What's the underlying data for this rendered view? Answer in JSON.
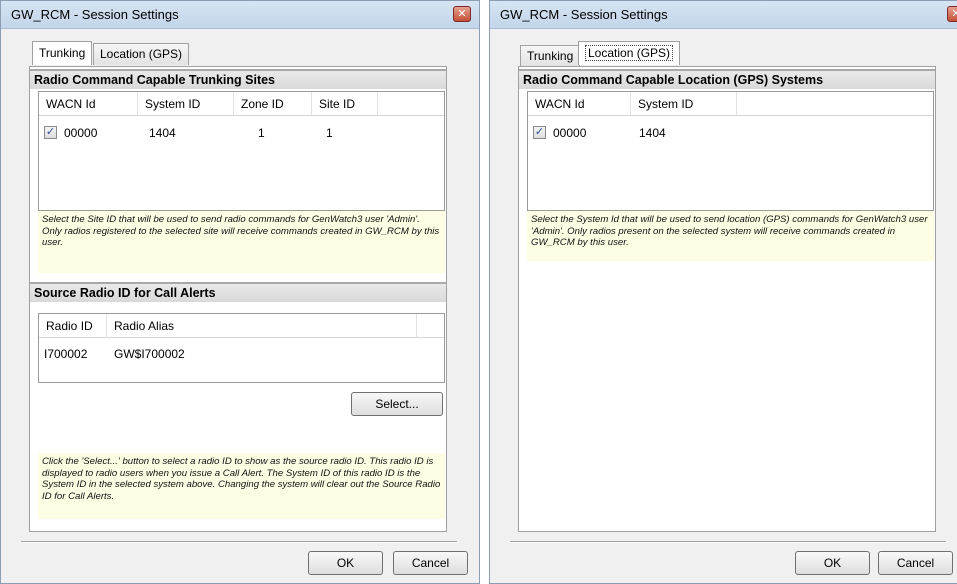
{
  "left_dialog": {
    "title": "GW_RCM - Session Settings",
    "tabs": [
      {
        "label": "Trunking",
        "active": true
      },
      {
        "label": "Location (GPS)",
        "active": false
      }
    ],
    "trunking": {
      "section_title": "Radio Command Capable Trunking Sites",
      "columns": [
        "WACN Id",
        "System ID",
        "Zone ID",
        "Site ID"
      ],
      "rows": [
        {
          "checked": true,
          "wacn_id": "00000",
          "system_id": "1404",
          "zone_id": "1",
          "site_id": "1"
        }
      ],
      "hint": "Select the Site ID that will be used to send radio commands for GenWatch3 user 'Admin'. Only radios registered to the selected site will receive commands created in GW_RCM by this user."
    },
    "source_radio": {
      "section_title": "Source Radio ID for Call Alerts",
      "columns": [
        "Radio ID",
        "Radio Alias"
      ],
      "rows": [
        {
          "radio_id": "I700002",
          "radio_alias": "GW$I700002"
        }
      ],
      "select_label": "Select...",
      "hint": "Click the 'Select...' button to select a radio ID to show as the source radio ID.  This radio ID is displayed to radio users when you issue a Call Alert.  The System ID of this radio ID is the System ID in the selected system above.  Changing the system will clear out the Source Radio ID for Call Alerts."
    },
    "ok_label": "OK",
    "cancel_label": "Cancel"
  },
  "right_dialog": {
    "title": "GW_RCM - Session Settings",
    "tabs": [
      {
        "label": "Trunking",
        "active": false
      },
      {
        "label": "Location (GPS)",
        "active": true
      }
    ],
    "location": {
      "section_title": "Radio Command Capable Location (GPS) Systems",
      "columns": [
        "WACN Id",
        "System ID"
      ],
      "rows": [
        {
          "checked": true,
          "wacn_id": "00000",
          "system_id": "1404"
        }
      ],
      "hint": "Select the System Id that will be used to send location (GPS) commands for GenWatch3 user 'Admin'. Only radios present on the selected system will receive commands created in GW_RCM by this user."
    },
    "ok_label": "OK",
    "cancel_label": "Cancel"
  },
  "icons": {
    "close": "close-icon",
    "checkbox": "checkmark-icon"
  },
  "colors": {
    "titlebar": "#c9dbef",
    "dialog_bg": "#f0f0f0",
    "hint_bg": "#fdfde4",
    "close_button": "#c45034"
  }
}
